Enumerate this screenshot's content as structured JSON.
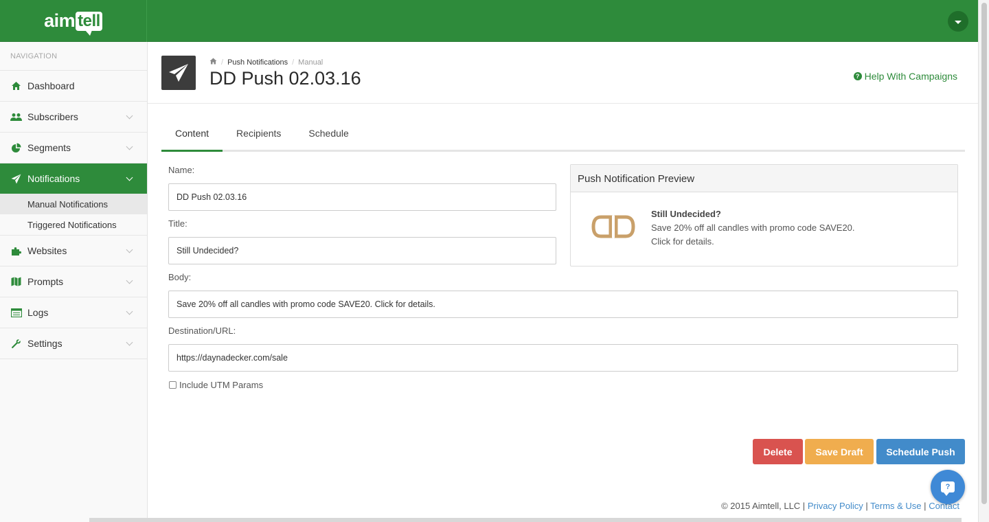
{
  "brand": {
    "text_a": "aim",
    "text_b": "tell"
  },
  "sidebar": {
    "heading": "NAVIGATION",
    "items": [
      {
        "label": "Dashboard",
        "icon": "home-icon"
      },
      {
        "label": "Subscribers",
        "icon": "users-icon"
      },
      {
        "label": "Segments",
        "icon": "pie-chart-icon"
      },
      {
        "label": "Notifications",
        "icon": "paper-plane-icon",
        "active": true
      },
      {
        "label": "Websites",
        "icon": "puzzle-icon"
      },
      {
        "label": "Prompts",
        "icon": "map-icon"
      },
      {
        "label": "Logs",
        "icon": "list-icon"
      },
      {
        "label": "Settings",
        "icon": "wrench-icon"
      }
    ],
    "sub_items": [
      {
        "label": "Manual Notifications",
        "current": true
      },
      {
        "label": "Triggered Notifications"
      }
    ]
  },
  "header": {
    "breadcrumb": {
      "section": "Push Notifications",
      "current": "Manual"
    },
    "title": "DD Push 02.03.16",
    "help": "Help With Campaigns"
  },
  "tabs": [
    "Content",
    "Recipients",
    "Schedule"
  ],
  "form": {
    "name_label": "Name:",
    "name_value": "DD Push 02.03.16",
    "title_label": "Title:",
    "title_value": "Still Undecided?",
    "body_label": "Body:",
    "body_value": "Save 20% off all candles with promo code SAVE20. Click for details.",
    "url_label": "Destination/URL:",
    "url_value": "https://daynadecker.com/sale",
    "utm_label": "Include UTM Params"
  },
  "preview": {
    "heading": "Push Notification Preview",
    "title": "Still Undecided?",
    "line1": "Save 20% off all candles with promo code SAVE20.",
    "line2": "Click for details."
  },
  "actions": {
    "delete": "Delete",
    "save_draft": "Save Draft",
    "schedule": "Schedule Push"
  },
  "footer": {
    "copyright": "© 2015 Aimtell, LLC |",
    "privacy": "Privacy Policy",
    "sep1": "|",
    "terms": "Terms & Use",
    "sep2": "|",
    "contact": "Contact"
  },
  "colors": {
    "brand_green": "#2e8b3b",
    "delete": "#d9534f",
    "draft": "#f0ad4e",
    "schedule": "#428bca",
    "logo_gold": "#c9a06a"
  }
}
